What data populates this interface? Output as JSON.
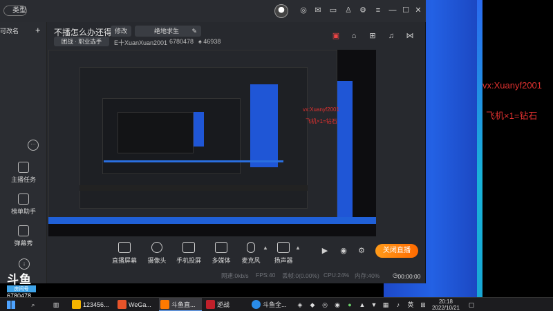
{
  "app": {
    "type_pill": "类型",
    "sidebar_top_label": "可改名",
    "room_title": "不播怎么办还得播",
    "modify_btn": "修改",
    "category_btn": "绝地求生",
    "category_tag": "团战 · 职业选手",
    "streamer": "E十XuanXuan2001",
    "room_id": "6780478",
    "fans": "46938"
  },
  "sidebar": {
    "items": [
      {
        "label": "主播任务"
      },
      {
        "label": "榜单助手"
      },
      {
        "label": "弹幕秀"
      }
    ]
  },
  "overlay": {
    "vx_text": "vx:Xuanyf2001",
    "promo_text": "飞机×1=钻石"
  },
  "toolbar": {
    "items": [
      {
        "label": "直播屏幕"
      },
      {
        "label": "摄像头"
      },
      {
        "label": "手机投屏"
      },
      {
        "label": "多媒体"
      },
      {
        "label": "麦克风"
      },
      {
        "label": "扬声器"
      }
    ],
    "close_live": "关闭直播"
  },
  "status": {
    "net": "网速:0kb/s",
    "fps": "FPS:40",
    "drop": "丢帧:0(0.00%)",
    "cpu": "CPU:24%",
    "mem": "内存:40%",
    "timer": "00:00:00"
  },
  "logo": {
    "word": "斗鱼",
    "badge": "房间号",
    "room": "6780478"
  },
  "taskbar": {
    "tasks": [
      {
        "label": "123456..."
      },
      {
        "label": "WeGa..."
      },
      {
        "label": "斗鱼直..."
      },
      {
        "label": "逆战"
      },
      {
        "label": "斗鱼全..."
      }
    ],
    "lang": "英",
    "time": "20:18",
    "date": "2022/10/21"
  }
}
